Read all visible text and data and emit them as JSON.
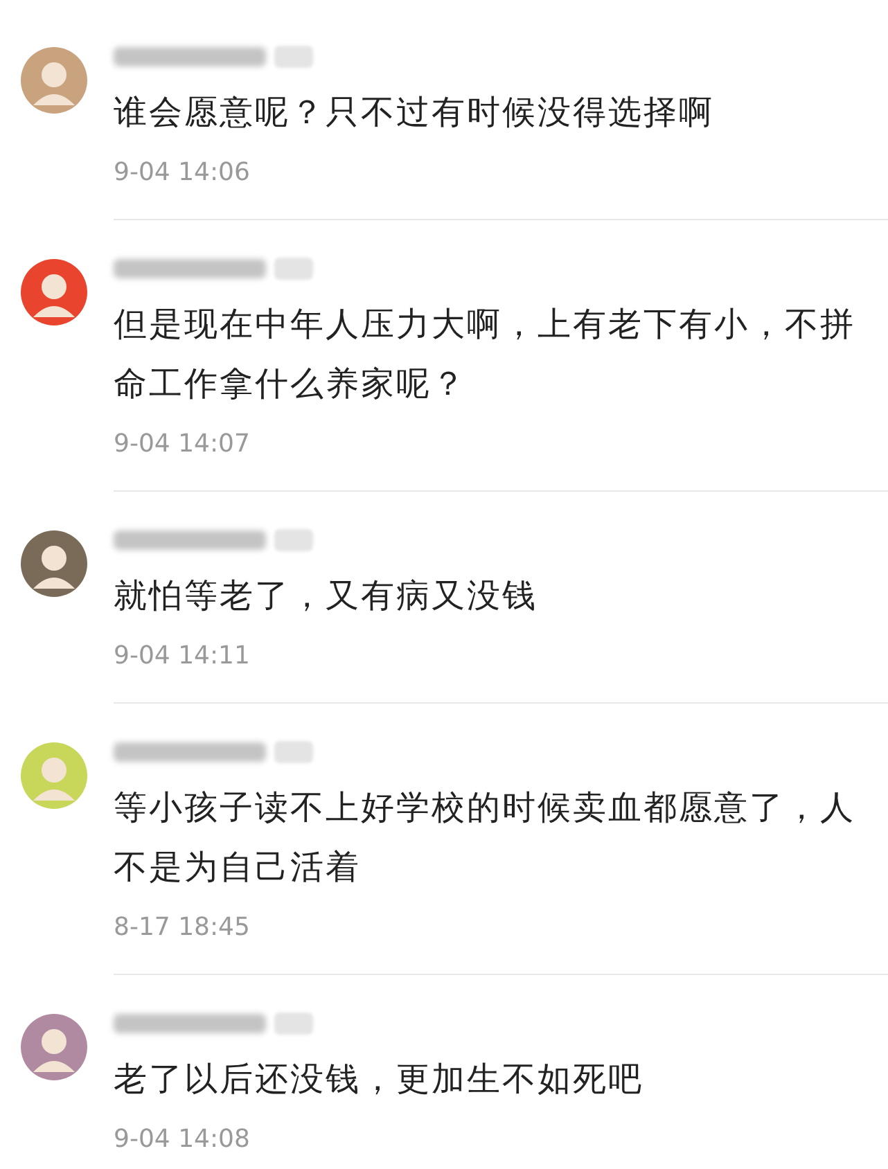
{
  "comments": [
    {
      "color": "#c9a27e",
      "text": "谁会愿意呢？只不过有时候没得选择啊",
      "time": "9-04 14:06"
    },
    {
      "color": "#e8442e",
      "text": "但是现在中年人压力大啊，上有老下有小，不拼命工作拿什么养家呢？",
      "time": "9-04 14:07"
    },
    {
      "color": "#7a6a58",
      "text": "就怕等老了，又有病又没钱",
      "time": "9-04 14:11"
    },
    {
      "color": "#c8d65a",
      "text": "等小孩子读不上好学校的时候卖血都愿意了，人不是为自己活着",
      "time": "8-17 18:45"
    },
    {
      "color": "#b08aa0",
      "text": "老了以后还没钱，更加生不如死吧",
      "time": "9-04 14:08"
    }
  ]
}
